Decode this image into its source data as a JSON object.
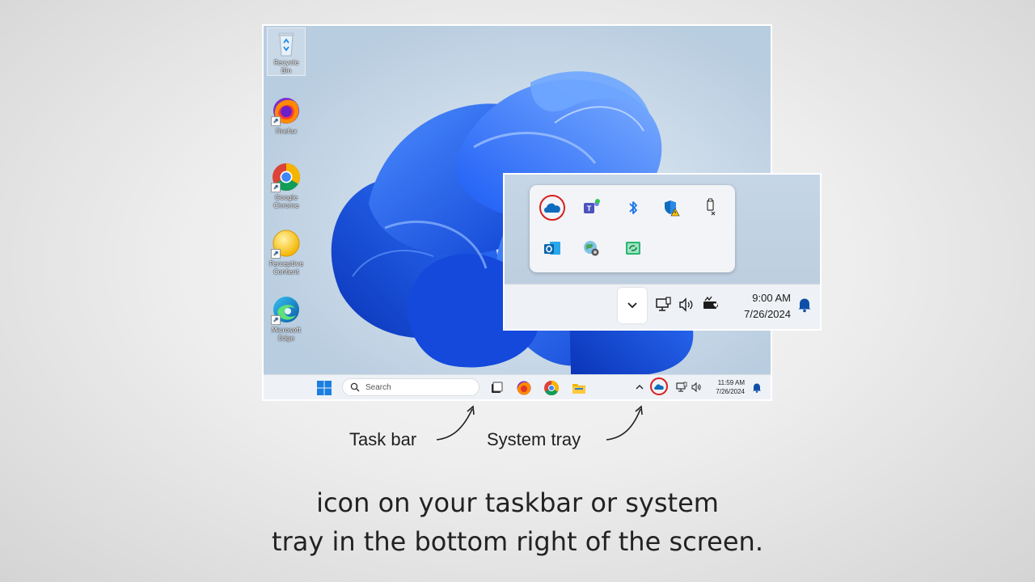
{
  "desktop": {
    "icons": [
      {
        "label": "Recycle Bin",
        "icon": "recycle-bin-icon"
      },
      {
        "label": "Firefox",
        "icon": "firefox-icon"
      },
      {
        "label": "Google Chrome",
        "icon": "chrome-icon"
      },
      {
        "label": "Perceptive Content",
        "icon": "perceptive-content-icon"
      },
      {
        "label": "Microsoft Edge",
        "icon": "edge-icon"
      }
    ]
  },
  "taskbar": {
    "search_placeholder": "Search",
    "apps": [
      "task-view-icon",
      "firefox-icon",
      "chrome-icon",
      "file-explorer-icon"
    ],
    "tray": {
      "time": "11:59 AM",
      "date": "7/26/2024",
      "icons": [
        "chevron-up-icon",
        "onedrive-cloud-icon",
        "network-icon",
        "volume-icon",
        "notification-bell-icon"
      ],
      "highlight_color": "#d81e1e"
    }
  },
  "inset": {
    "flyout_icons": [
      "onedrive-cloud-icon",
      "teams-icon",
      "bluetooth-icon",
      "windows-security-warning-icon",
      "usb-eject-icon",
      "outlook-icon",
      "vpn-globe-icon",
      "sync-icon"
    ],
    "time": "9:00 AM",
    "date": "7/26/2024"
  },
  "annotations": {
    "taskbar_label": "Task bar",
    "tray_label": "System tray"
  },
  "caption": {
    "line1": "icon on your taskbar or system",
    "line2": "tray in the bottom right of the screen."
  },
  "colors": {
    "accent_blue": "#1a66e8",
    "onedrive_blue": "#0f6cbd",
    "highlight_red": "#d81e1e"
  }
}
